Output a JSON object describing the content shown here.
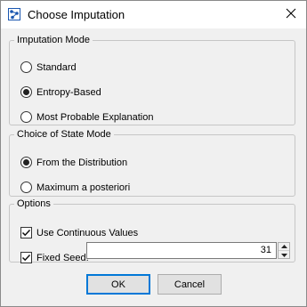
{
  "window": {
    "title": "Choose Imputation",
    "app_icon": "bayes-net-icon",
    "close_icon": "close-icon"
  },
  "imputation_mode": {
    "legend": "Imputation Mode",
    "options": [
      {
        "label": "Standard",
        "selected": false
      },
      {
        "label": "Entropy-Based",
        "selected": true
      },
      {
        "label": "Most Probable Explanation",
        "selected": false
      }
    ]
  },
  "state_mode": {
    "legend": "Choice of State Mode",
    "options": [
      {
        "label": "From the Distribution",
        "selected": true
      },
      {
        "label": "Maximum a posteriori",
        "selected": false
      }
    ]
  },
  "options": {
    "legend": "Options",
    "use_continuous": {
      "label": "Use Continuous Values",
      "checked": true
    },
    "fixed_seed": {
      "label": "Fixed Seed:",
      "checked": true,
      "value": "31"
    }
  },
  "buttons": {
    "ok": "OK",
    "cancel": "Cancel"
  },
  "colors": {
    "dialog_bg": "#f0f0f0",
    "accent": "#0078d7"
  }
}
